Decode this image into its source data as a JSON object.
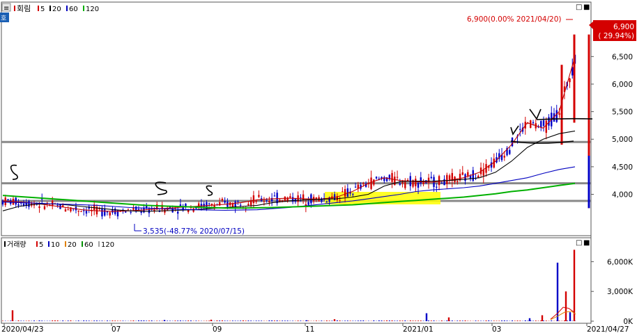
{
  "chart_data": [
    {
      "type": "candlestick",
      "panel": "price",
      "legend": [
        {
          "label": "회림",
          "color": "#d40000"
        },
        {
          "label": "5",
          "color": "#d40000"
        },
        {
          "label": "20",
          "color": "#000000"
        },
        {
          "label": "60",
          "color": "#0000c0"
        },
        {
          "label": "120",
          "color": "#00b000"
        }
      ],
      "y_ticks": [
        "6,500",
        "6,000",
        "5,500",
        "5,000",
        "4,500",
        "4,000"
      ],
      "ylim": [
        3300,
        7400
      ],
      "current_price": "6,900",
      "current_change": "( 29.94%)",
      "high_annotation": "6,900(0.00% 2021/04/20)",
      "low_annotation": "3,535(-48.77% 2020/07/15)",
      "support_lines": [
        4950,
        4200,
        3880
      ],
      "resistance_marks": [
        5300
      ],
      "series": [
        {
          "name": "5",
          "color": "#c00000",
          "values": [
            3880,
            3860,
            3840,
            3800,
            3760,
            3720,
            3700,
            3690,
            3700,
            3720,
            3740,
            3760,
            3780,
            3800,
            3820,
            3850,
            3900,
            3920,
            3930,
            3920,
            3910,
            3950,
            4050,
            4200,
            4300,
            4250,
            4230,
            4220,
            4250,
            4300,
            4400,
            4600,
            4900,
            5300,
            5200,
            5500,
            6500
          ]
        },
        {
          "name": "20",
          "color": "#000000",
          "values": [
            3700,
            3780,
            3820,
            3830,
            3810,
            3780,
            3750,
            3720,
            3700,
            3690,
            3700,
            3710,
            3720,
            3740,
            3760,
            3780,
            3800,
            3850,
            3880,
            3900,
            3910,
            3920,
            3950,
            4000,
            4150,
            4230,
            4240,
            4240,
            4250,
            4270,
            4300,
            4400,
            4600,
            4850,
            5000,
            5100,
            5150
          ]
        },
        {
          "name": "60",
          "color": "#0000c0",
          "values": [
            3860,
            3850,
            3840,
            3830,
            3820,
            3810,
            3800,
            3780,
            3760,
            3750,
            3740,
            3730,
            3720,
            3715,
            3710,
            3715,
            3720,
            3740,
            3760,
            3790,
            3820,
            3850,
            3880,
            3920,
            3960,
            4000,
            4050,
            4080,
            4100,
            4120,
            4150,
            4200,
            4250,
            4300,
            4380,
            4450,
            4500
          ]
        },
        {
          "name": "120",
          "color": "#00b000",
          "values": [
            3980,
            3960,
            3940,
            3920,
            3900,
            3880,
            3860,
            3840,
            3820,
            3800,
            3790,
            3780,
            3770,
            3760,
            3750,
            3750,
            3755,
            3760,
            3770,
            3780,
            3790,
            3800,
            3810,
            3830,
            3850,
            3870,
            3890,
            3910,
            3930,
            3950,
            3980,
            4010,
            4050,
            4080,
            4120,
            4160,
            4200
          ]
        }
      ]
    },
    {
      "type": "bar",
      "panel": "volume",
      "legend": [
        {
          "label": "거래량",
          "color": "#000000"
        },
        {
          "label": "5",
          "color": "#d40000"
        },
        {
          "label": "10",
          "color": "#0000c0"
        },
        {
          "label": "20",
          "color": "#e08000"
        },
        {
          "label": "60",
          "color": "#009000"
        },
        {
          "label": "120",
          "color": "#a0a0a0"
        }
      ],
      "y_ticks": [
        "6,000K",
        "3,000K",
        "0K"
      ],
      "ylim": [
        0,
        7500
      ],
      "spikes": [
        1100,
        120,
        150,
        90,
        200,
        800,
        380,
        300,
        600,
        5900,
        3000,
        900,
        7200
      ]
    }
  ],
  "x_axis": {
    "labels": [
      "2020/04/23",
      "07",
      "09",
      "11",
      "2021/01",
      "03",
      "2021/04/27"
    ]
  },
  "ui": {
    "menu_icon": "≡",
    "window_icon": "□",
    "close_icon": "■",
    "marker_icon": "호"
  }
}
